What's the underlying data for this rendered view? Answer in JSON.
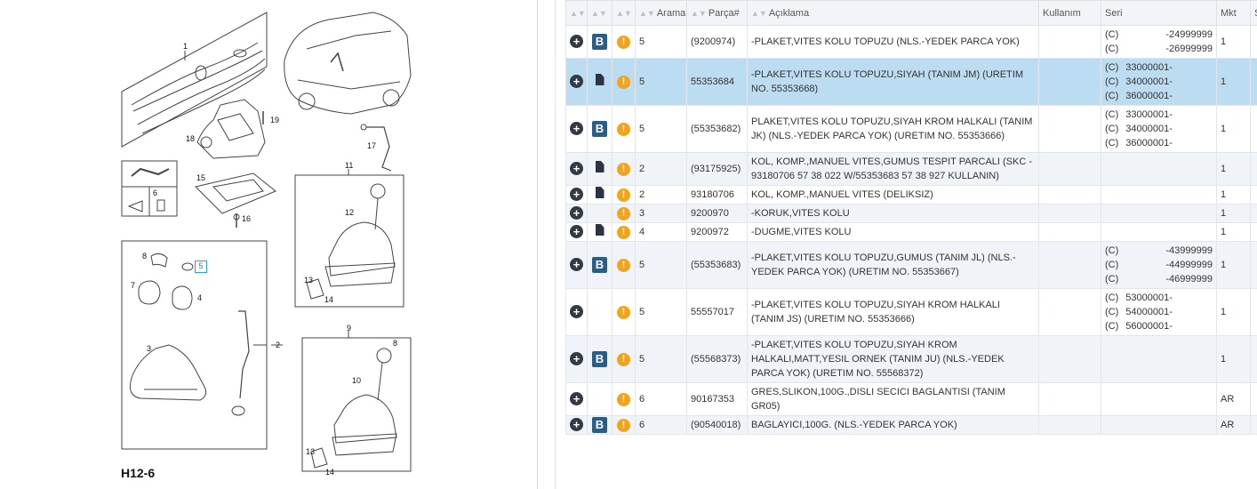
{
  "diagram": {
    "page_code": "H12-6",
    "callouts": {
      "c1": "1",
      "c2": "2",
      "c3": "3",
      "c4": "4",
      "c5": "5",
      "c6": "6",
      "c7": "7",
      "c8a": "8",
      "c8b": "8",
      "c9": "9",
      "c10": "10",
      "c11": "11",
      "c12": "12",
      "c13a": "13",
      "c13b": "13",
      "c14a": "14",
      "c14b": "14",
      "c15": "15",
      "c16": "16",
      "c17": "17",
      "c18": "18",
      "c19": "19"
    }
  },
  "table": {
    "headers": {
      "h_search": "Arama",
      "h_part": "Parça#",
      "h_desc": "Açıklama",
      "h_usage": "Kullanım",
      "h_series": "Seri",
      "h_qty": "Mkt",
      "h_s": "S"
    },
    "rows": [
      {
        "b": true,
        "doc": false,
        "warn": true,
        "arama": "5",
        "part": "(9200974)",
        "desc": "-PLAKET,VITES KOLU TOPUZU (NLS.-YEDEK PARCA YOK)",
        "usage": "",
        "series": [
          {
            "c": "(C)",
            "v": "-24999999"
          },
          {
            "c": "(C)",
            "v": "-26999999"
          }
        ],
        "series_align": "right",
        "qty": "1",
        "style": "row-white"
      },
      {
        "b": false,
        "doc": true,
        "warn": true,
        "arama": "5",
        "part": "55353684",
        "desc": "-PLAKET,VITES KOLU TOPUZU,SIYAH (TANIM JM) (URETIM NO. 55353668)",
        "usage": "",
        "series": [
          {
            "c": "(C)",
            "v": "33000001-"
          },
          {
            "c": "(C)",
            "v": "34000001-"
          },
          {
            "c": "(C)",
            "v": "36000001-"
          }
        ],
        "series_align": "left",
        "qty": "1",
        "style": "row-sel"
      },
      {
        "b": true,
        "doc": false,
        "warn": true,
        "arama": "5",
        "part": "(55353682)",
        "desc": "PLAKET,VITES KOLU TOPUZU,SIYAH KROM HALKALI (TANIM JK) (NLS.-YEDEK PARCA YOK) (URETIM NO. 55353666)",
        "usage": "",
        "series": [
          {
            "c": "(C)",
            "v": "33000001-"
          },
          {
            "c": "(C)",
            "v": "34000001-"
          },
          {
            "c": "(C)",
            "v": "36000001-"
          }
        ],
        "series_align": "left",
        "qty": "1",
        "style": "row-white"
      },
      {
        "b": false,
        "doc": true,
        "warn": true,
        "arama": "2",
        "part": "(93175925)",
        "desc": "KOL, KOMP.,MANUEL VITES,GUMUS TESPIT PARCALI (SKC - 93180706 57 38 022 W/55353683 57 38 927 KULLANIN)",
        "usage": "",
        "series": [],
        "series_align": "left",
        "qty": "1",
        "style": "row-alt"
      },
      {
        "b": false,
        "doc": true,
        "warn": true,
        "arama": "2",
        "part": "93180706",
        "desc": "KOL, KOMP.,MANUEL VITES (DELIKSIZ)",
        "usage": "",
        "series": [],
        "series_align": "left",
        "qty": "1",
        "style": "row-white"
      },
      {
        "b": false,
        "doc": false,
        "warn": true,
        "arama": "3",
        "part": "9200970",
        "desc": "-KORUK,VITES KOLU",
        "usage": "",
        "series": [],
        "series_align": "left",
        "qty": "1",
        "style": "row-alt"
      },
      {
        "b": false,
        "doc": true,
        "warn": true,
        "arama": "4",
        "part": "9200972",
        "desc": "-DUGME,VITES KOLU",
        "usage": "",
        "series": [],
        "series_align": "left",
        "qty": "1",
        "style": "row-white"
      },
      {
        "b": true,
        "doc": false,
        "warn": true,
        "arama": "5",
        "part": "(55353683)",
        "desc": "-PLAKET,VITES KOLU TOPUZU,GUMUS (TANIM JL) (NLS.-YEDEK PARCA YOK) (URETIM NO. 55353667)",
        "usage": "",
        "series": [
          {
            "c": "(C)",
            "v": "-43999999"
          },
          {
            "c": "(C)",
            "v": "-44999999"
          },
          {
            "c": "(C)",
            "v": "-46999999"
          }
        ],
        "series_align": "right",
        "qty": "1",
        "style": "row-alt"
      },
      {
        "b": false,
        "doc": false,
        "warn": true,
        "arama": "5",
        "part": "55557017",
        "desc": "-PLAKET,VITES KOLU TOPUZU,SIYAH KROM HALKALI (TANIM JS) (URETIM NO. 55353666)",
        "usage": "",
        "series": [
          {
            "c": "(C)",
            "v": "53000001-"
          },
          {
            "c": "(C)",
            "v": "54000001-"
          },
          {
            "c": "(C)",
            "v": "56000001-"
          }
        ],
        "series_align": "left",
        "qty": "1",
        "style": "row-white"
      },
      {
        "b": true,
        "doc": false,
        "warn": true,
        "arama": "5",
        "part": "(55568373)",
        "desc": "-PLAKET,VITES KOLU TOPUZU,SIYAH KROM HALKALI,MATT,YESIL ORNEK (TANIM JU) (NLS.-YEDEK PARCA YOK) (URETIM NO. 55568372)",
        "usage": "",
        "series": [],
        "series_align": "left",
        "qty": "1",
        "style": "row-alt"
      },
      {
        "b": false,
        "doc": false,
        "warn": true,
        "arama": "6",
        "part": "90167353",
        "desc": "GRES,SLIKON,100G.,DISLI SECICI BAGLANTISI (TANIM GR05)",
        "usage": "",
        "series": [],
        "series_align": "left",
        "qty": "AR",
        "style": "row-white"
      },
      {
        "b": true,
        "doc": false,
        "warn": true,
        "arama": "6",
        "part": "(90540018)",
        "desc": "BAGLAYICI,100G. (NLS.-YEDEK PARCA YOK)",
        "usage": "",
        "series": [],
        "series_align": "left",
        "qty": "AR",
        "style": "row-alt"
      }
    ],
    "icons": {
      "expand": "plus-circle-icon",
      "bulletin": "b-badge-icon",
      "document": "document-icon",
      "warning": "warning-icon",
      "sort": "sort-arrows-icon"
    }
  },
  "colors": {
    "selected_row": "#bcdcf2",
    "alt_row": "#f0f4f8",
    "badge": "#2b5d86",
    "warning": "#f2a31a"
  }
}
